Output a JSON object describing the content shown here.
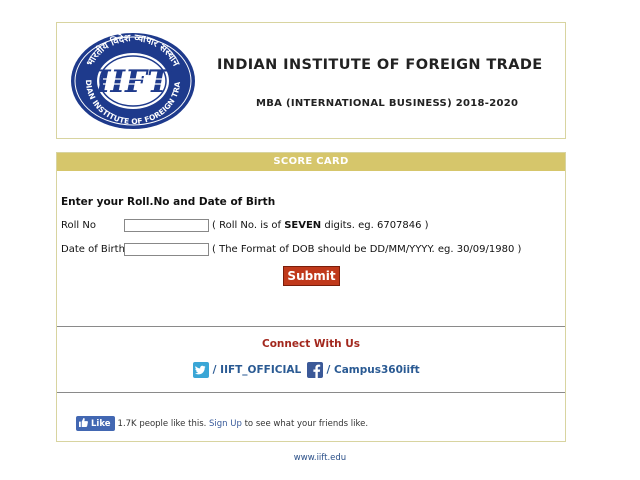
{
  "header": {
    "logo": {
      "icon": "iift-seal-logo",
      "top_text": "भारतीय विदेश व्यापार संस्थान",
      "monogram": "IIFT",
      "bottom_text": "INDIAN INSTITUTE OF FOREIGN TRADE"
    },
    "title": "INDIAN INSTITUTE OF FOREIGN TRADE",
    "program": "MBA (INTERNATIONAL BUSINESS) 2018-2020"
  },
  "scorecard": {
    "heading": "SCORE CARD",
    "prompt": "Enter your Roll.No and  Date of Birth",
    "roll": {
      "label": "Roll No",
      "value": "",
      "hint_prefix": "( Roll No. is of ",
      "hint_bold": "SEVEN",
      "hint_suffix": " digits. eg. 6707846 )"
    },
    "dob": {
      "label": "Date of Birth",
      "value": "",
      "hint": "( The Format of DOB should be DD/MM/YYYY.  eg. 30/09/1980 )"
    },
    "submit_label": "Submit"
  },
  "connect": {
    "heading": "Connect With Us",
    "twitter": {
      "icon": "twitter-icon",
      "sep": "/",
      "handle": "IIFT_OFFICIAL"
    },
    "facebook": {
      "icon": "facebook-icon",
      "sep": "/",
      "handle": "Campus360iift"
    }
  },
  "fb_like": {
    "button_label": "Like",
    "count_text": "1.7K people like this.",
    "signup_link": "Sign Up",
    "suffix": "to see what your friends like."
  },
  "footer": {
    "link": "www.iift.edu"
  },
  "colors": {
    "card_header": "#d6c66b",
    "border": "#d8d4a0",
    "submit_bg": "#c0391b",
    "connect_heading": "#a2271d",
    "social_text": "#2a5a93",
    "logo_blue": "#1e3a8c"
  }
}
